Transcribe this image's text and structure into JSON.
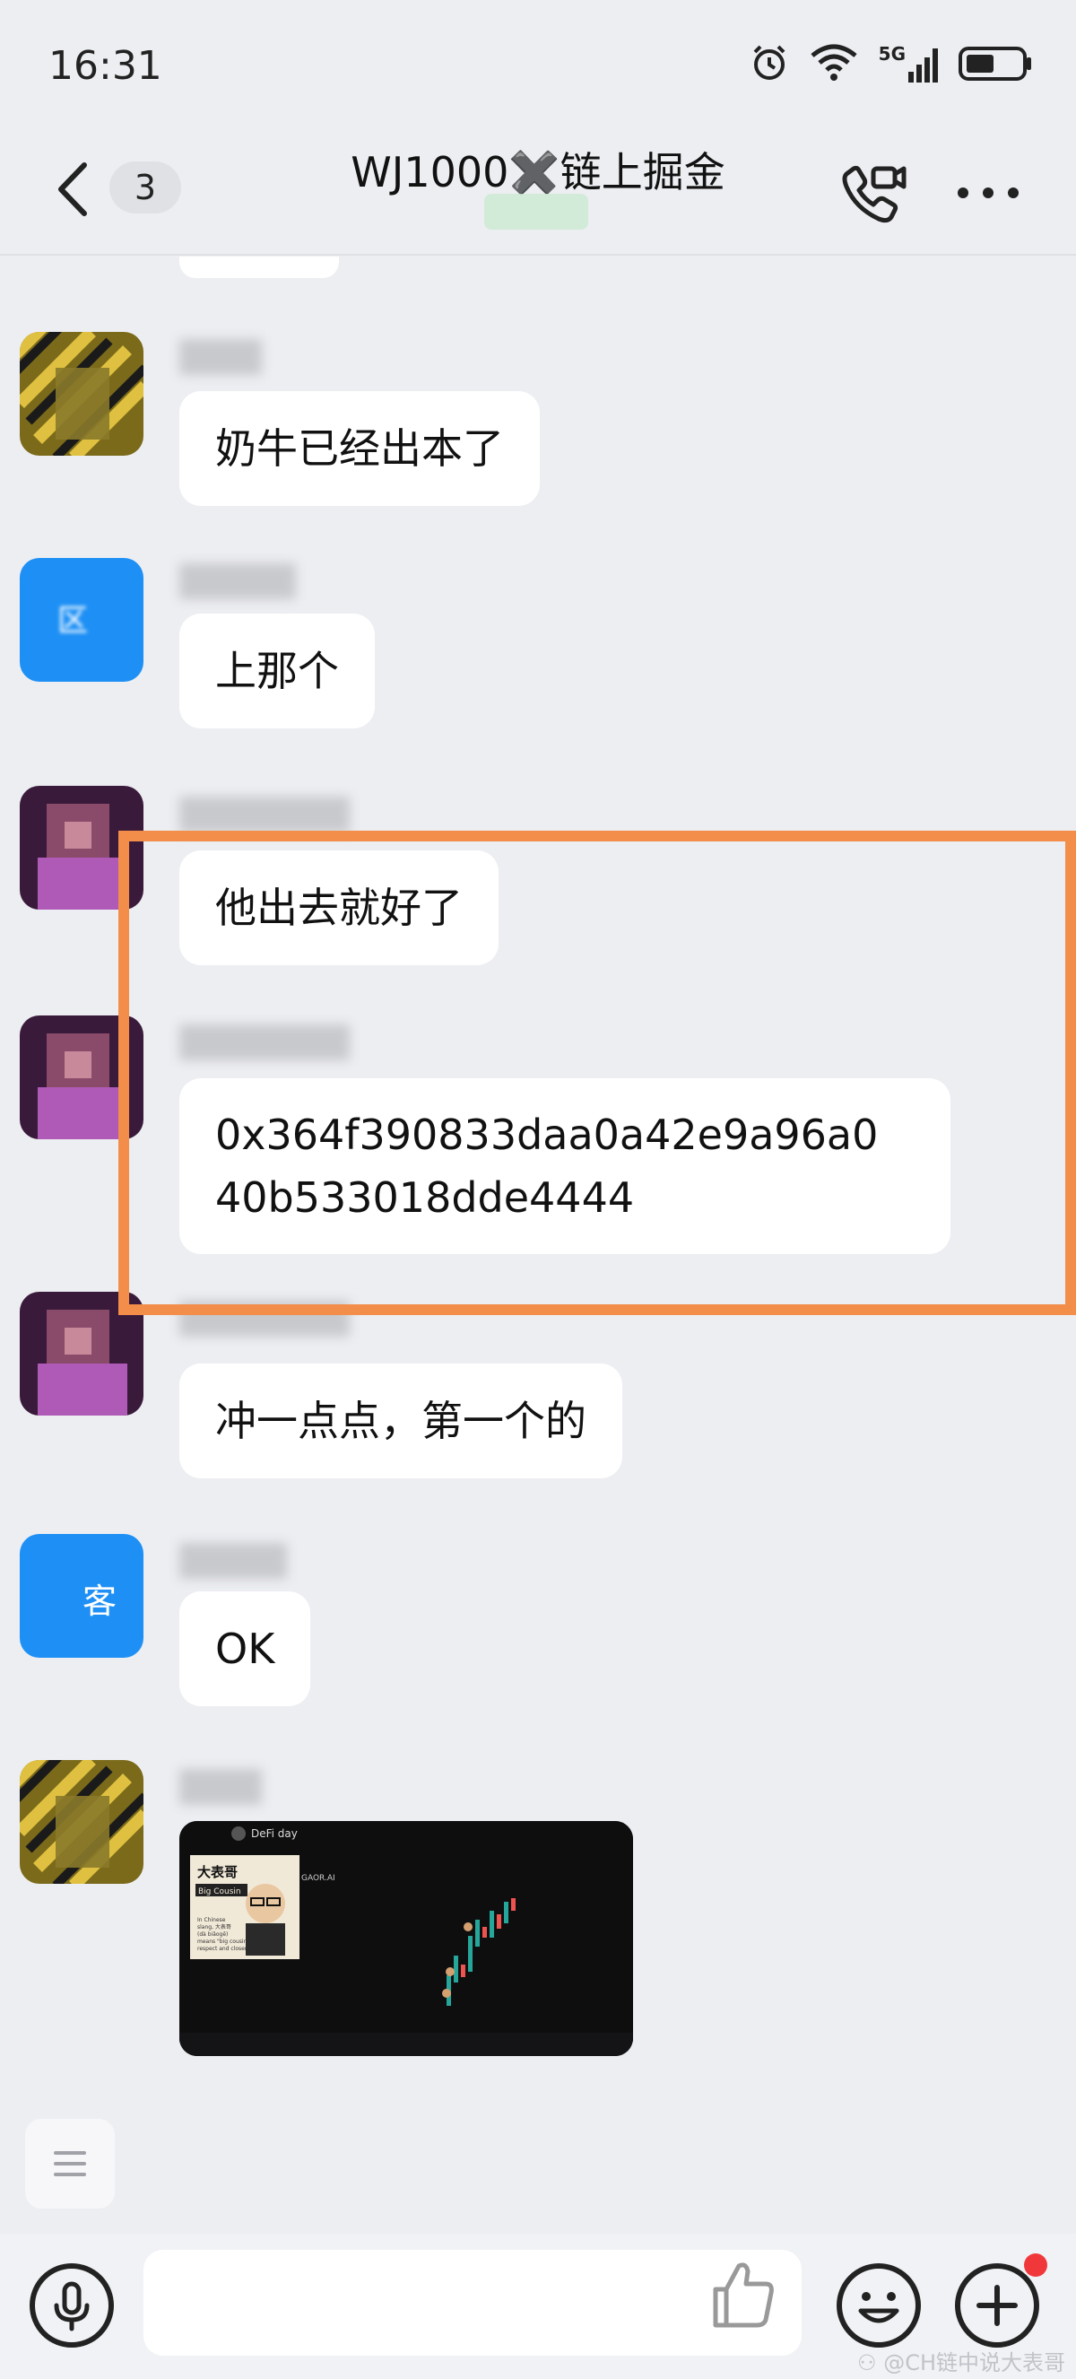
{
  "status_bar": {
    "time": "16:31",
    "icons": [
      "alarm-icon",
      "wifi-icon",
      "signal-5g-icon",
      "battery-icon"
    ],
    "network_label": "5G"
  },
  "header": {
    "unread_count": "3",
    "title": "WJ1000✖️链上掘金"
  },
  "messages": [
    {
      "id": "m1",
      "text": "奶牛已经出本了"
    },
    {
      "id": "m2",
      "text": "上那个",
      "avatar_text": "区"
    },
    {
      "id": "m3",
      "text": "他出去就好了"
    },
    {
      "id": "m4",
      "text": "0x364f390833daa0a42e9a96a040b533018dde4444",
      "line1": "0x364f390833daa0a42e9a96a0",
      "line2": "40b533018dde4444"
    },
    {
      "id": "m5",
      "text": "冲一点点，第一个的"
    },
    {
      "id": "m6",
      "text": "OK",
      "avatar_text": "客"
    },
    {
      "id": "m7",
      "type": "image"
    }
  ],
  "image_message": {
    "app_title": "DeFi day",
    "ticker": "GAOR.AI",
    "meme_title": "大表哥",
    "meme_subtitle": "Big Cousin",
    "meme_caption_1": "In Chinese",
    "meme_caption_2": "slang, 大表哥",
    "meme_caption_3": "(dà biǎogē)",
    "meme_caption_4": "means \"big cousin,\" implying",
    "meme_caption_5": "respect and closeness."
  },
  "colors": {
    "highlight_border": "#F28E4A",
    "background": "#EDEEF2",
    "notification_dot": "#F0383B"
  },
  "watermark": "⚇ @CH链中说大表哥"
}
